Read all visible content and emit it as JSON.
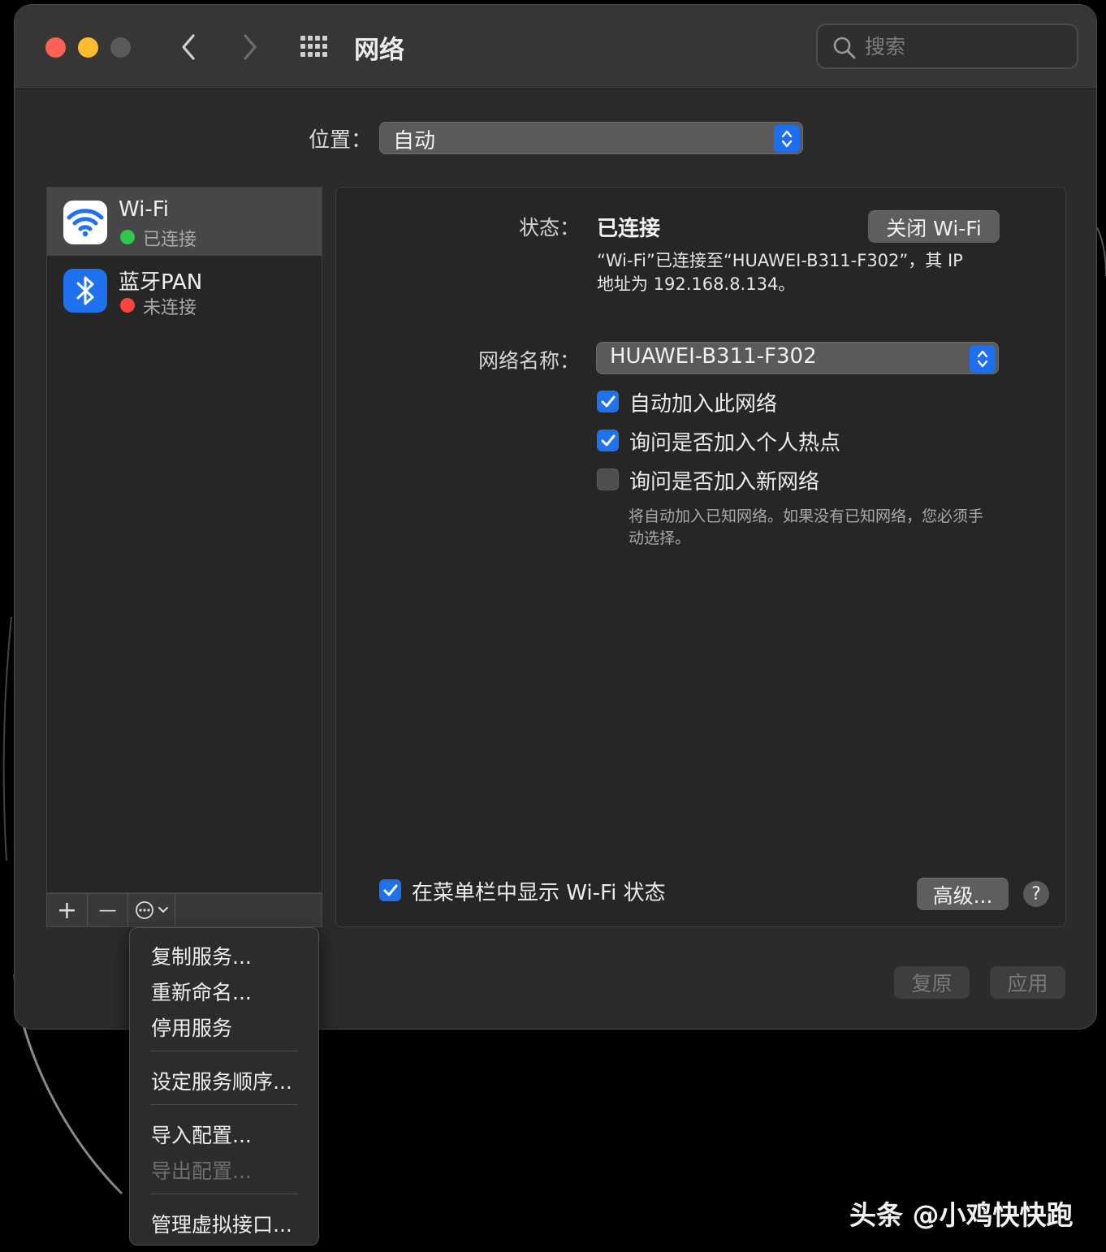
{
  "window": {
    "title": "网络",
    "search_placeholder": "搜索"
  },
  "location": {
    "label": "位置：",
    "value": "自动"
  },
  "services": [
    {
      "name": "Wi-Fi",
      "status": "已连接",
      "status_color": "#2dc84d",
      "icon": "wifi-icon",
      "selected": true
    },
    {
      "name": "蓝牙PAN",
      "status": "未连接",
      "status_color": "#fe453b",
      "icon": "bluetooth-icon",
      "selected": false
    }
  ],
  "sidebar_toolbar": {
    "add": "+",
    "remove": "—"
  },
  "detail": {
    "status_label": "状态：",
    "status_value": "已连接",
    "turn_off_button": "关闭 Wi-Fi",
    "description_line1": "“Wi-Fi”已连接至“HUAWEI-B311-F302”，其 IP",
    "description_line2": "地址为 192.168.8.134。",
    "network_name_label": "网络名称：",
    "network_name_value": "HUAWEI-B311-F302",
    "options": [
      {
        "label": "自动加入此网络",
        "checked": true
      },
      {
        "label": "询问是否加入个人热点",
        "checked": true
      },
      {
        "label": "询问是否加入新网络",
        "checked": false
      }
    ],
    "hint_line1": "将自动加入已知网络。如果没有已知网络，您必须手",
    "hint_line2": "动选择。",
    "show_in_menubar": {
      "label": "在菜单栏中显示 Wi-Fi 状态",
      "checked": true
    },
    "advanced_button": "高级...",
    "help_button": "?"
  },
  "footer": {
    "revert_button": "复原",
    "apply_button": "应用"
  },
  "action_menu": {
    "items": [
      {
        "label": "复制服务...",
        "enabled": true
      },
      {
        "label": "重新命名...",
        "enabled": true
      },
      {
        "label": "停用服务",
        "enabled": true
      },
      {
        "label": "设定服务顺序...",
        "enabled": true
      },
      {
        "label": "导入配置...",
        "enabled": true
      },
      {
        "label": "导出配置...",
        "enabled": false
      },
      {
        "label": "管理虚拟接口...",
        "enabled": true
      }
    ]
  },
  "watermark": "头条 @小鸡快快跑",
  "colors": {
    "accent": "#1f71ee",
    "connected": "#2dc84d",
    "disconnected": "#fe453b"
  }
}
